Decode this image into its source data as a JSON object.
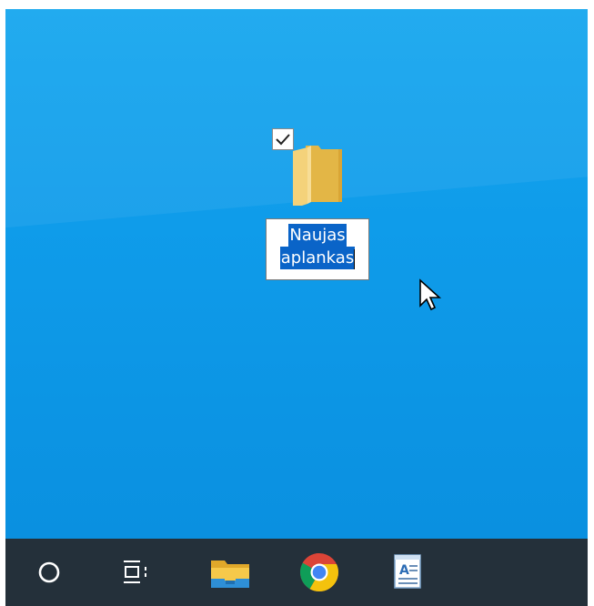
{
  "desktop": {
    "icons": [
      {
        "icon": "folder-icon",
        "checked": true,
        "rename": {
          "lines": [
            "Naujas",
            "aplankas"
          ],
          "selected": true
        }
      }
    ],
    "background_color": "#0f9cea",
    "selection_color": "#0a64c8"
  },
  "taskbar": {
    "background_color": "#24303a",
    "items": [
      {
        "icon": "search-circle-icon"
      },
      {
        "icon": "task-view-icon"
      },
      {
        "icon": "file-explorer-icon"
      },
      {
        "icon": "chrome-icon"
      },
      {
        "icon": "wordpad-icon"
      }
    ]
  }
}
